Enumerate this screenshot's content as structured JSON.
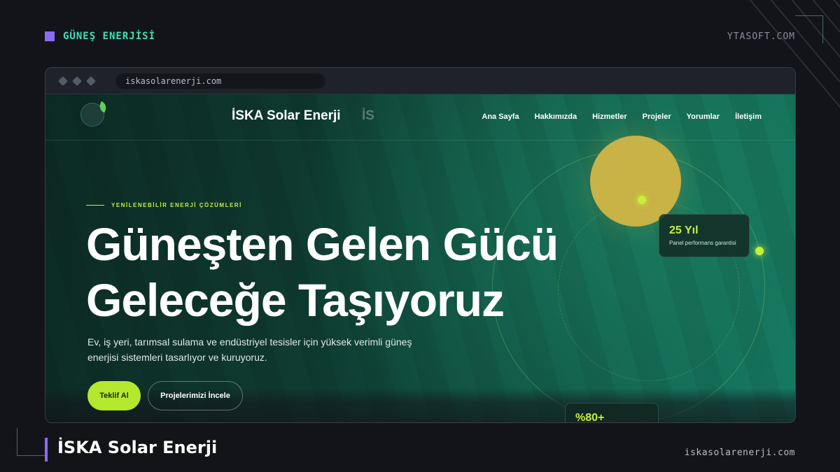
{
  "header": {
    "tag": "GÜNEŞ ENERJİSİ",
    "brand": "YTASOFT.COM"
  },
  "browser": {
    "url": "iskasolarenerji.com"
  },
  "site": {
    "title": "İSKA Solar Enerji",
    "ghost_text": "İS",
    "nav": [
      "Ana Sayfa",
      "Hakkımızda",
      "Hizmetler",
      "Projeler",
      "Yorumlar",
      "İletişim"
    ],
    "eyebrow": "YENİLENEBİLİR ENERJİ ÇÖZÜMLERİ",
    "hero_line1": "Güneşten Gelen Gücü",
    "hero_line2": "Geleceğe Taşıyoruz",
    "hero_desc": "Ev, iş yeri, tarımsal sulama ve endüstriyel tesisler için yüksek verimli güneş enerjisi sistemleri tasarlıyor ve kuruyoruz.",
    "cta_primary": "Teklif Al",
    "cta_secondary": "Projelerimizi İncele",
    "card_years": {
      "value": "25 Yıl",
      "label": "Panel performans garantisi"
    },
    "card_percent": {
      "value": "%80+"
    }
  },
  "footer": {
    "title": "İSKA Solar Enerji",
    "url": "iskasolarenerji.com"
  },
  "colors": {
    "accent_purple": "#8b6cf0",
    "accent_teal": "#3ee0b4",
    "accent_lime": "#c6f03a",
    "sun": "#c9b246"
  }
}
